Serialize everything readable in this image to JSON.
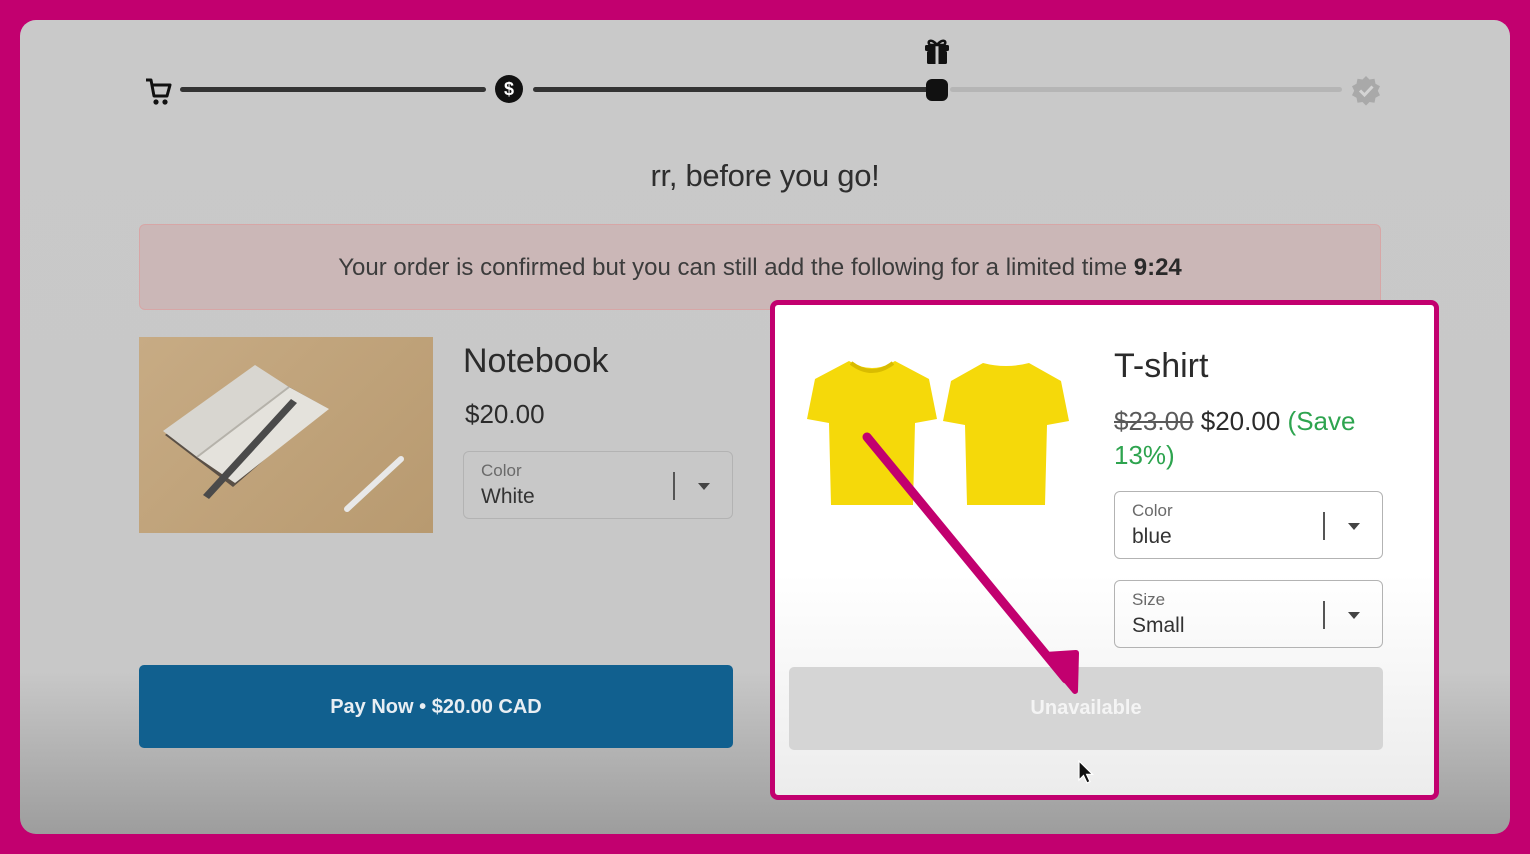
{
  "steps": [
    {
      "name": "cart",
      "icon": "cart-icon"
    },
    {
      "name": "payment",
      "icon": "dollar-icon"
    },
    {
      "name": "upsell",
      "icon": "gift-icon"
    },
    {
      "name": "confirmed",
      "icon": "verified-icon"
    }
  ],
  "page": {
    "title": "rr, before you go!"
  },
  "banner": {
    "text": "Your order is confirmed but you can still add the following for a limited time",
    "timer": "9:24"
  },
  "notebook": {
    "name": "Notebook",
    "price": "$20.00",
    "color_label": "Color",
    "color_value": "White"
  },
  "pay_button": {
    "label": "Pay Now • $20.00 CAD"
  },
  "tshirt": {
    "name": "T-shirt",
    "old_price": "$23.00",
    "price": "$20.00",
    "save_line1": "(Save",
    "save_line2": "13%)",
    "color_label": "Color",
    "color_value": "blue",
    "size_label": "Size",
    "size_value": "Small",
    "button_label": "Unavailable"
  },
  "colors": {
    "highlight": "#c2006f",
    "pay_button": "#11608f",
    "save_green": "#2ea44f",
    "tshirt_yellow": "#f5d90a"
  }
}
